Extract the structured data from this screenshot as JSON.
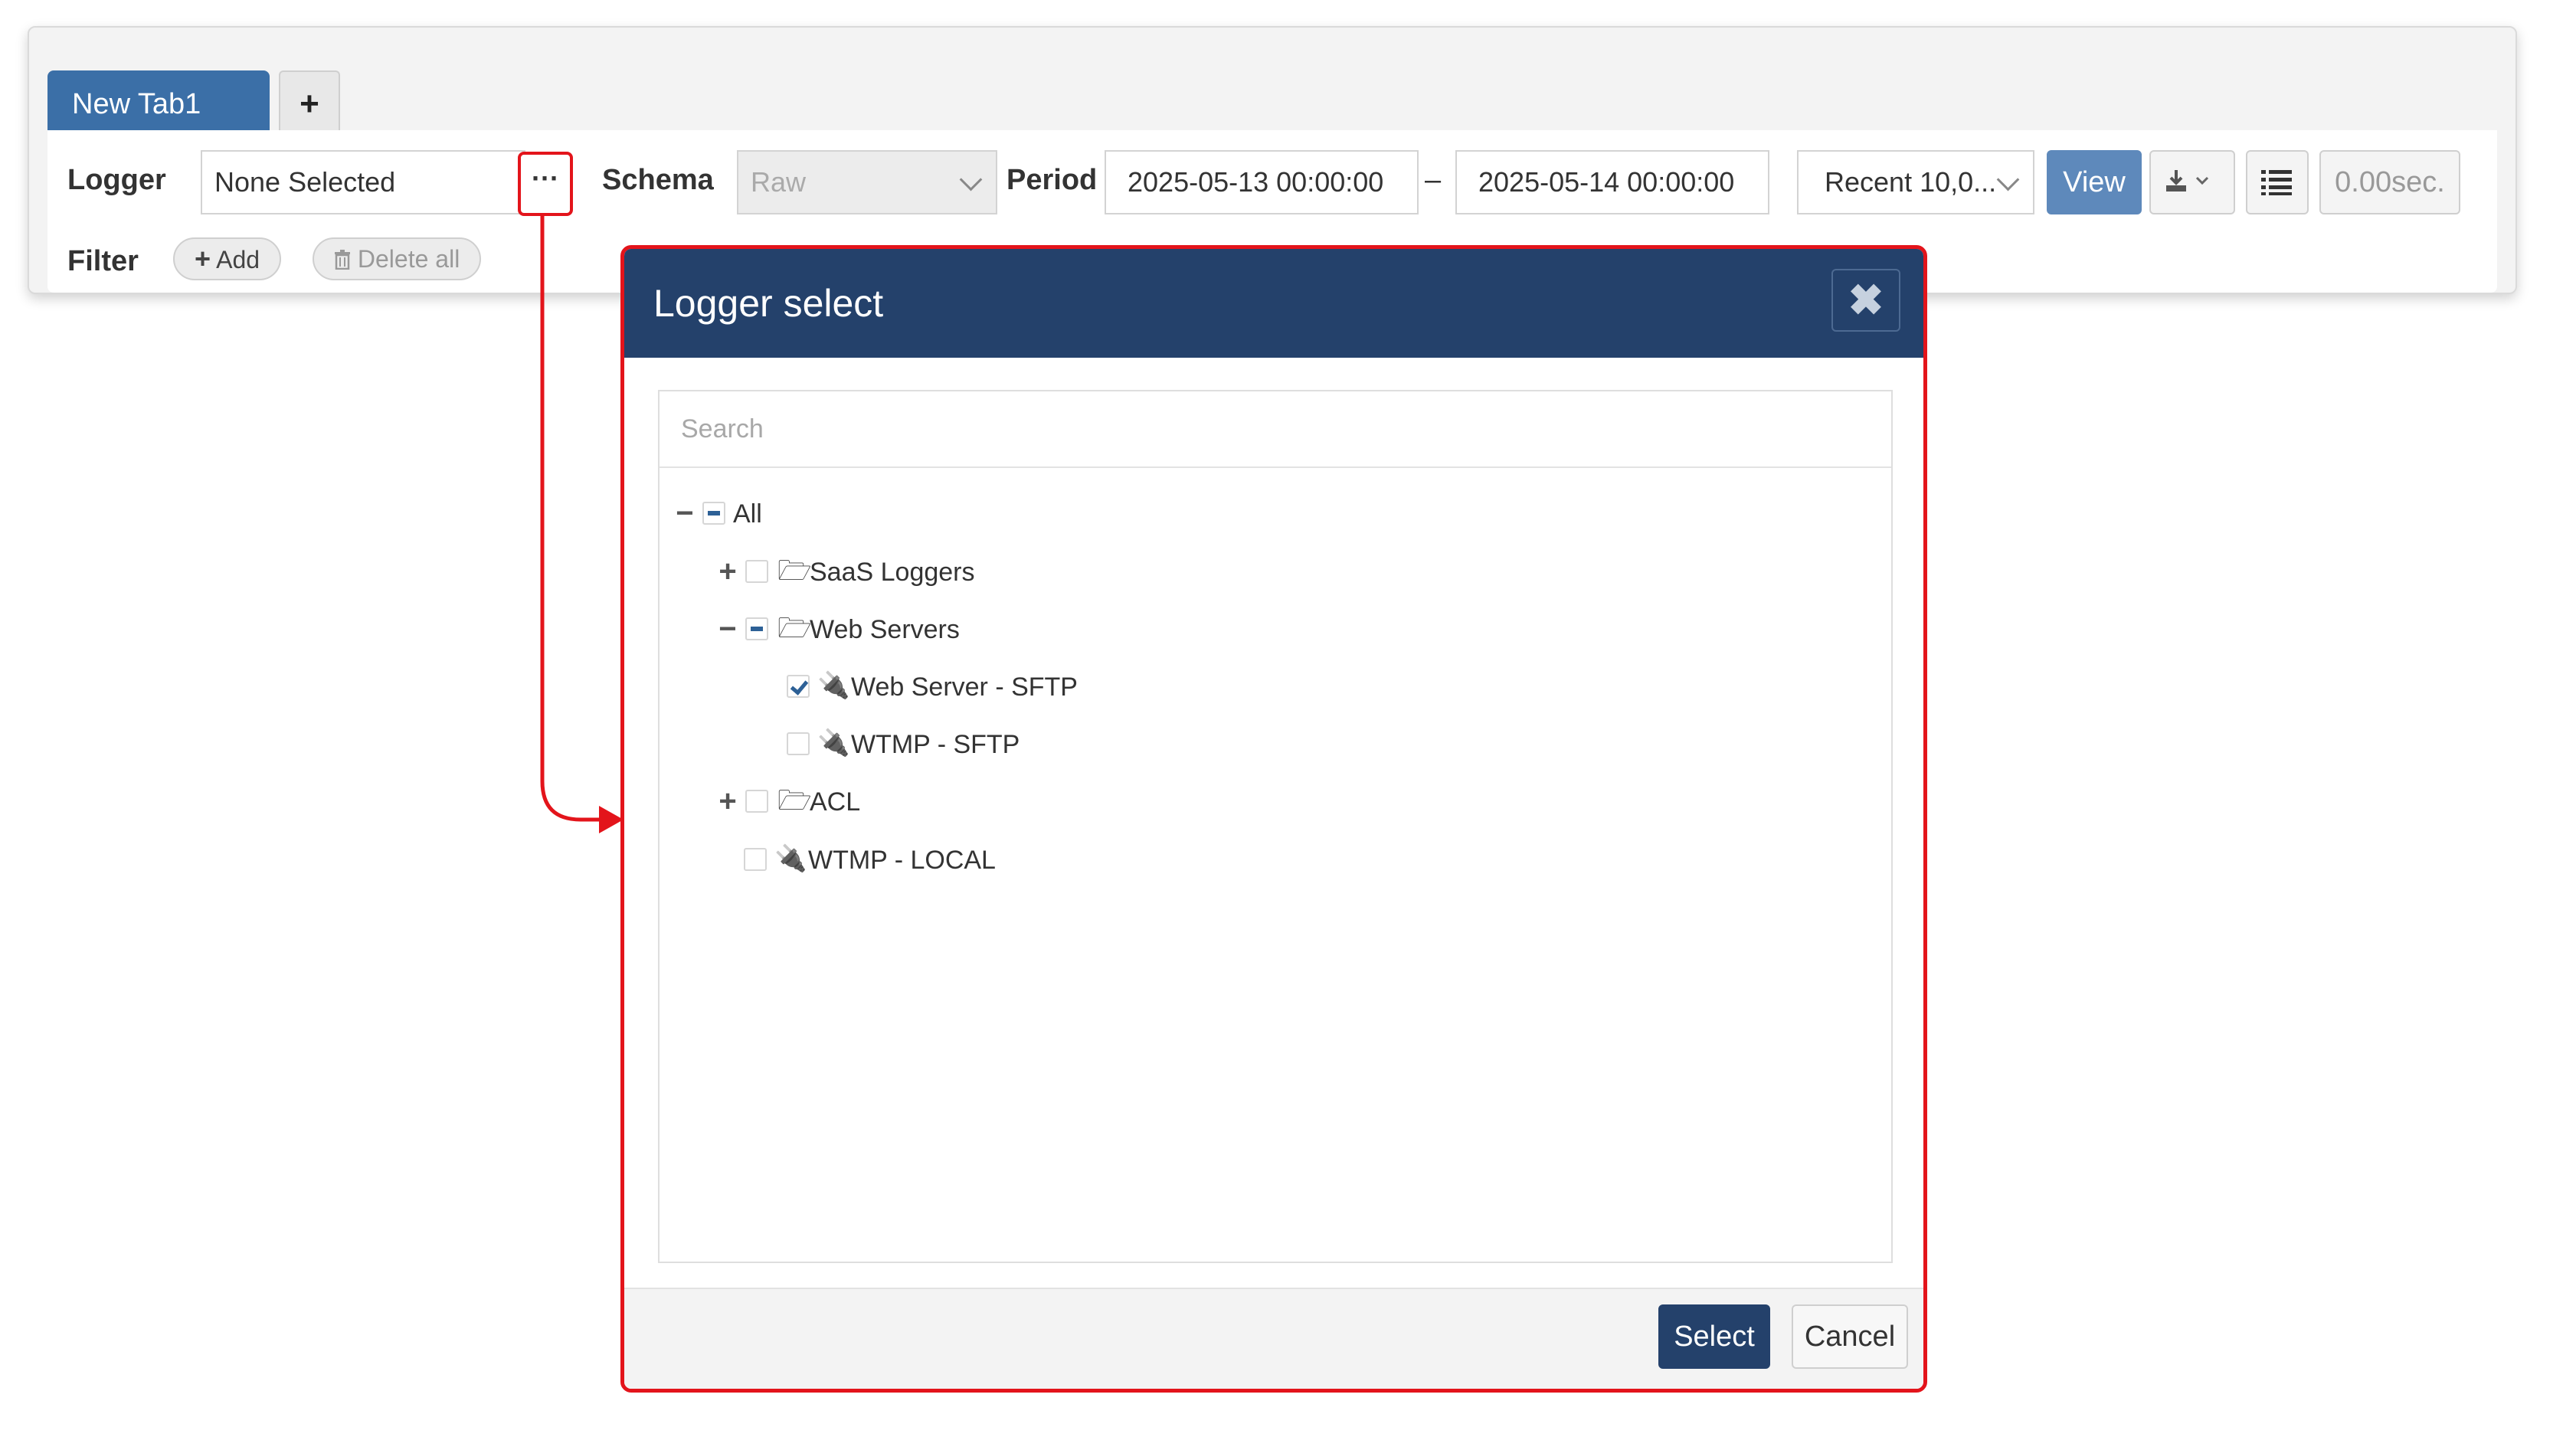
{
  "tabs": {
    "active_label": "New Tab1",
    "add_symbol": "+"
  },
  "toolbar": {
    "logger_label": "Logger",
    "logger_value": "None Selected",
    "logger_browse_label": "···",
    "schema_label": "Schema",
    "schema_value": "Raw",
    "period_label": "Period",
    "period_from": "2025-05-13 00:00:00",
    "period_separator": "–",
    "period_to": "2025-05-14 00:00:00",
    "recent_value": "Recent 10,0...",
    "view_label": "View",
    "download_icon": "download-icon",
    "list_icon": "list-icon",
    "elapsed": "0.00sec.",
    "filter_label": "Filter",
    "add_label": "Add",
    "delete_all_label": "Delete all"
  },
  "modal": {
    "title": "Logger select",
    "close_icon": "close-icon",
    "search_placeholder": "Search",
    "tree": {
      "all": "All",
      "saas_loggers": "SaaS Loggers",
      "web_servers": "Web Servers",
      "web_server_sftp": "Web Server - SFTP",
      "wtmp_sftp": "WTMP - SFTP",
      "acl": "ACL",
      "wtmp_local": "WTMP - LOCAL"
    },
    "select_label": "Select",
    "cancel_label": "Cancel"
  },
  "colors": {
    "header_navy": "#24416b",
    "tab_blue": "#3b6fa7",
    "highlight_red": "#e3141b",
    "check_blue": "#2d6096"
  }
}
